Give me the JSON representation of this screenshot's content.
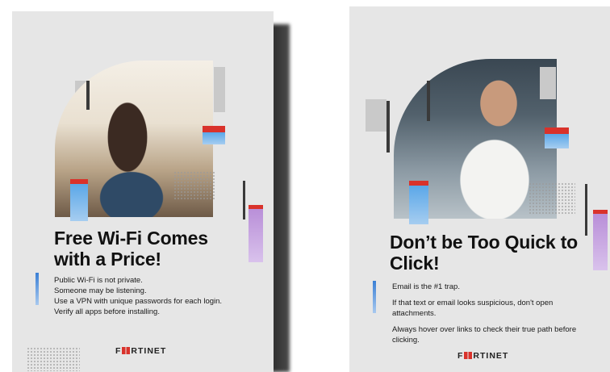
{
  "posters": [
    {
      "headline": "Free Wi-Fi Comes with a Price!",
      "lines": [
        "Public Wi-Fi is not private.",
        "Someone may be listening.",
        "Use a VPN with unique passwords for each login.",
        "Verify all apps before installing."
      ],
      "logo_prefix": "F",
      "logo_suffix": "RTINET"
    },
    {
      "headline": "Don’t be Too Quick to Click!",
      "lines": [
        "Email is the #1 trap.",
        "If that text or email looks suspicious, don't open attachments.",
        "Always hover over links to check their true path before clicking."
      ],
      "logo_prefix": "F",
      "logo_suffix": "RTINET"
    }
  ],
  "colors": {
    "accent_red": "#d9322b",
    "accent_blue": "#5aa7e8",
    "accent_violet": "#b98fd8",
    "background": "#e6e6e6"
  }
}
